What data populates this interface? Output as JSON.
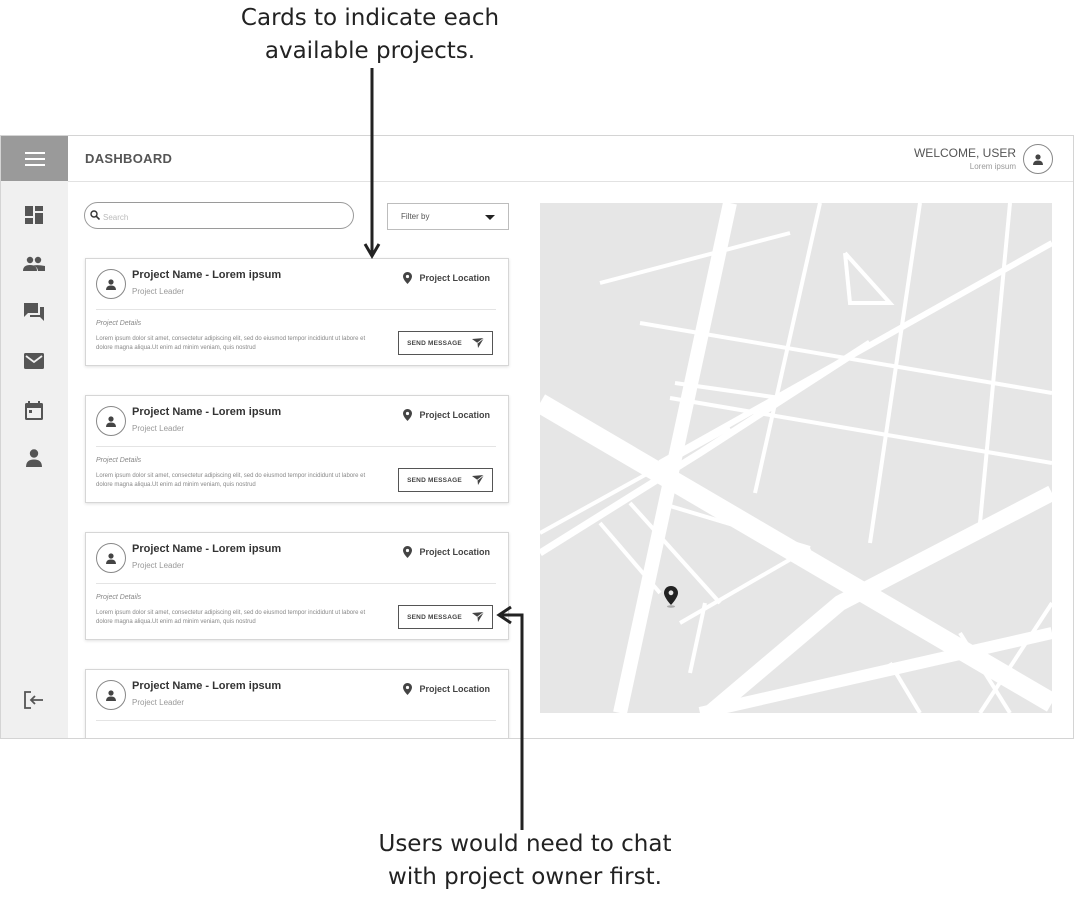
{
  "annotations": {
    "top": "Cards to indicate each\navailable projects.",
    "bottom": "Users would need to chat\nwith project owner first."
  },
  "topbar": {
    "title": "DASHBOARD",
    "welcome": "WELCOME, USER",
    "welcome_sub": "Lorem ipsum"
  },
  "search": {
    "placeholder": "Search",
    "value": ""
  },
  "filter": {
    "label": "Filter by"
  },
  "sidebar": {
    "items": [
      {
        "icon": "dashboard-icon"
      },
      {
        "icon": "people-icon"
      },
      {
        "icon": "chat-icon"
      },
      {
        "icon": "mail-icon"
      },
      {
        "icon": "calendar-icon"
      },
      {
        "icon": "person-icon"
      }
    ],
    "logout_icon": "logout-icon"
  },
  "cards": [
    {
      "title": "Project Name - Lorem ipsum",
      "leader": "Project Leader",
      "location": "Project Location",
      "details_label": "Project Details",
      "description": "Lorem ipsum dolor sit amet, consectetur adipiscing elit, sed do eiusmod tempor incididunt ut labore et dolore magna aliqua.Ut enim ad minim veniam, quis nostrud",
      "button": "SEND MESSAGE"
    },
    {
      "title": "Project Name - Lorem ipsum",
      "leader": "Project Leader",
      "location": "Project Location",
      "details_label": "Project Details",
      "description": "Lorem ipsum dolor sit amet, consectetur adipiscing elit, sed do eiusmod tempor incididunt ut labore et dolore magna aliqua.Ut enim ad minim veniam, quis nostrud",
      "button": "SEND MESSAGE"
    },
    {
      "title": "Project Name - Lorem ipsum",
      "leader": "Project Leader",
      "location": "Project Location",
      "details_label": "Project Details",
      "description": "Lorem ipsum dolor sit amet, consectetur adipiscing elit, sed do eiusmod tempor incididunt ut labore et dolore magna aliqua.Ut enim ad minim veniam, quis nostrud",
      "button": "SEND MESSAGE"
    },
    {
      "title": "Project Name - Lorem ipsum",
      "leader": "Project Leader",
      "location": "Project Location"
    }
  ],
  "colors": {
    "sidebar_bg": "#f0f0f0",
    "menu_button_bg": "#9a9a9a",
    "map_bg": "#e6e6e6",
    "map_roads": "#ffffff"
  }
}
